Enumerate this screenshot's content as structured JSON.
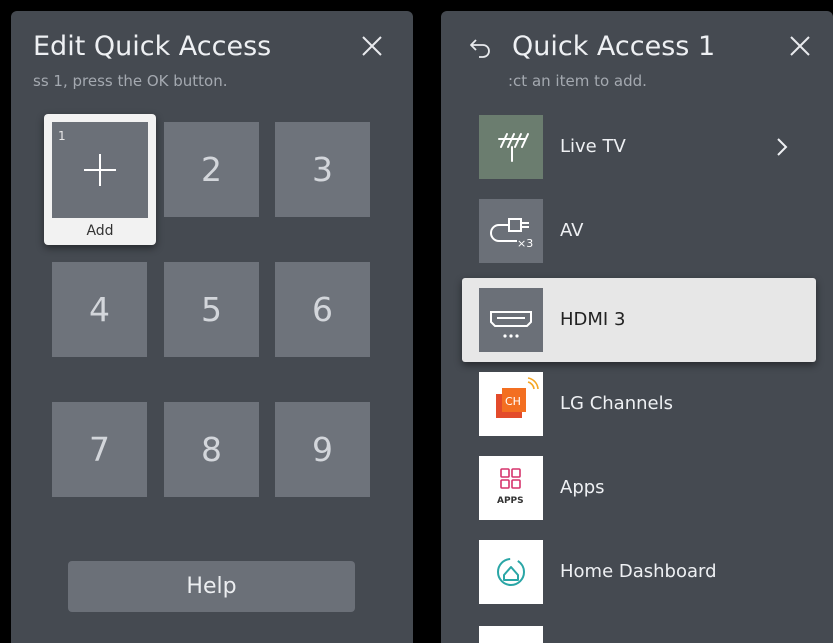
{
  "left": {
    "title": "Edit Quick Access",
    "subtitle": "ss 1, press the OK button.",
    "add_slot_number": "1",
    "add_label": "Add",
    "tiles": [
      "2",
      "3",
      "4",
      "5",
      "6",
      "7",
      "8",
      "9"
    ],
    "help_label": "Help"
  },
  "right": {
    "title": "Quick Access 1",
    "subtitle": ":ct an item to add.",
    "items": [
      {
        "label": "Live TV",
        "icon": "antenna-icon",
        "has_submenu": true
      },
      {
        "label": "AV",
        "icon": "av-cable-icon",
        "badge": "×3"
      },
      {
        "label": "HDMI 3",
        "icon": "hdmi-icon",
        "selected": true
      },
      {
        "label": "LG Channels",
        "icon": "lg-channels-icon",
        "badge": "CH"
      },
      {
        "label": "Apps",
        "icon": "apps-icon",
        "badge": "APPS"
      },
      {
        "label": "Home Dashboard",
        "icon": "home-dashboard-icon"
      }
    ]
  },
  "colors": {
    "panel": "#454a51",
    "tile": "#6e737b",
    "selected_bg": "#e7e7e7",
    "live_tv_thumb": "#6b7d6f",
    "lg_channels_accent": "#f36f21",
    "apps_pink": "#d6336c",
    "dashboard_teal": "#2aa6a6"
  }
}
